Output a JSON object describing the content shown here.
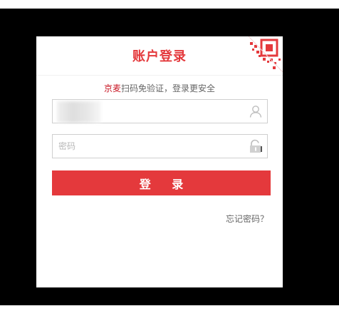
{
  "login": {
    "title": "账户登录",
    "hint_brand": "京麦",
    "hint_rest": "扫码免验证，登录更安全",
    "username_value": "",
    "password_placeholder": "密码",
    "login_label": "登 录",
    "forgot_label": "忘记密码？"
  },
  "icons": {
    "qr_corner": "qr-code-icon",
    "username": "user-icon",
    "password": "lock-icon"
  },
  "colors": {
    "accent": "#e4393c",
    "brand": "#c81623",
    "background": "#000000"
  }
}
